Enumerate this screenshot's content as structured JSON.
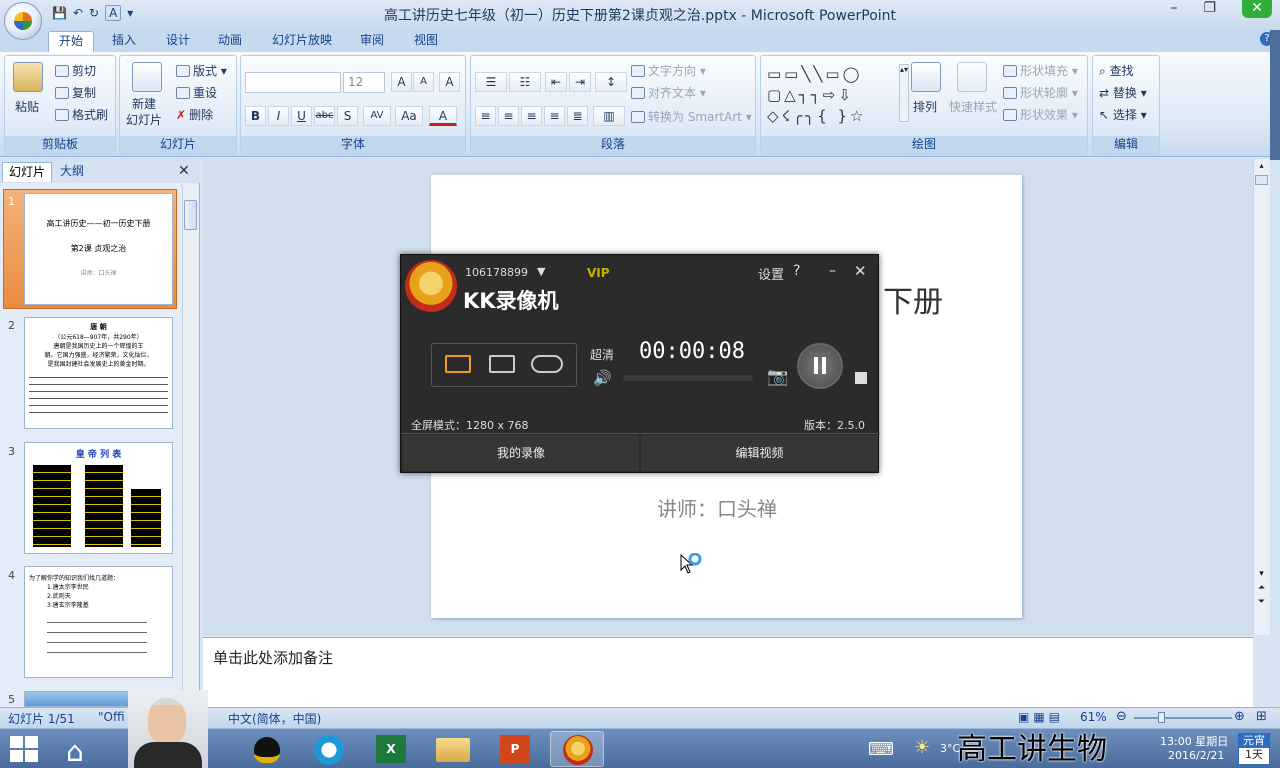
{
  "window": {
    "title": "高工讲历史七年级（初一）历史下册第2课贞观之治.pptx - Microsoft PowerPoint",
    "controls": {
      "minimize": "–",
      "restore": "❐",
      "close": "✕"
    },
    "help": "?"
  },
  "qat": {
    "save": "💾",
    "undo": "↶",
    "redo": "↻",
    "format": "A",
    "more": "▾"
  },
  "tabs": [
    "开始",
    "插入",
    "设计",
    "动画",
    "幻灯片放映",
    "审阅",
    "视图"
  ],
  "ribbon": {
    "clipboard": {
      "label": "剪贴板",
      "paste": "粘贴",
      "cut": "剪切",
      "copy": "复制",
      "format_painter": "格式刷"
    },
    "slides": {
      "label": "幻灯片",
      "new_slide": "新建\n幻灯片",
      "layout": "版式",
      "reset": "重设",
      "delete": "删除"
    },
    "font": {
      "label": "字体",
      "size": "12",
      "bold": "B",
      "italic": "I",
      "underline": "U",
      "strike": "abc",
      "shadow": "S",
      "spacing": "AV",
      "case": "Aa",
      "color": "A",
      "grow": "A",
      "shrink": "A",
      "clear": "A"
    },
    "paragraph": {
      "label": "段落",
      "text_direction": "文字方向",
      "align_text": "对齐文本",
      "smartart": "转换为 SmartArt"
    },
    "drawing": {
      "label": "绘图",
      "arrange": "排列",
      "quick_styles": "快速样式",
      "shape_fill": "形状填充",
      "shape_outline": "形状轮廓",
      "shape_effects": "形状效果"
    },
    "editing": {
      "label": "编辑",
      "find": "查找",
      "replace": "替换",
      "select": "选择"
    }
  },
  "slide_pane": {
    "tabs": [
      "幻灯片",
      "大纲"
    ],
    "close": "✕",
    "thumbs": [
      {
        "num": "1",
        "lines": [
          "高工讲历史——初一历史下册",
          "第2课 贞观之治",
          "讲师：口头禅"
        ]
      },
      {
        "num": "2",
        "lines": [
          "唐 朝",
          "（公元618—907年，共290年）",
          "唐朝是我国历史上的一个辉煌的王",
          "朝。它国力强盛，经济繁荣，文化灿烂，",
          "是我国封建社会发展史上的黄金时期。"
        ]
      },
      {
        "num": "3",
        "lines": [
          "皇 帝 列 表"
        ]
      },
      {
        "num": "4",
        "lines": [
          "为了解你学的知识我们找几道题：",
          "1.唐太宗李世民",
          "2.武则天",
          "3.唐玄宗李隆基"
        ]
      },
      {
        "num": "5",
        "lines": []
      }
    ]
  },
  "slide": {
    "title_fragment": "下册",
    "lecturer": "讲师：口头禅"
  },
  "notes": {
    "placeholder": "单击此处添加备注"
  },
  "kk": {
    "account": "106178899",
    "vip": "VIP",
    "name": "KK录像机",
    "settings": "设置",
    "help": "?",
    "minimize": "–",
    "close": "✕",
    "quality": "超清",
    "timer": "00:00:08",
    "mode": "全屏模式：1280 x 768",
    "version": "版本：2.5.0",
    "my_recordings": "我的录像",
    "edit_video": "编辑视频"
  },
  "statusbar": {
    "slide": "幻灯片 1/51",
    "theme": "\"Offi",
    "lang": "中文(简体，中国)",
    "zoom": "61%"
  },
  "taskbar": {
    "weather": "3°C",
    "time": "13:00 星期日",
    "date": "2016/2/21",
    "calendar_top": "元宵",
    "calendar_bottom": "1天"
  },
  "watermark": "高工讲生物",
  "colors": {
    "ribbon_blue": "#15428b",
    "kk_bg": "#2b2b2b",
    "kk_accent": "#f5a623",
    "vip": "#c9b000"
  }
}
